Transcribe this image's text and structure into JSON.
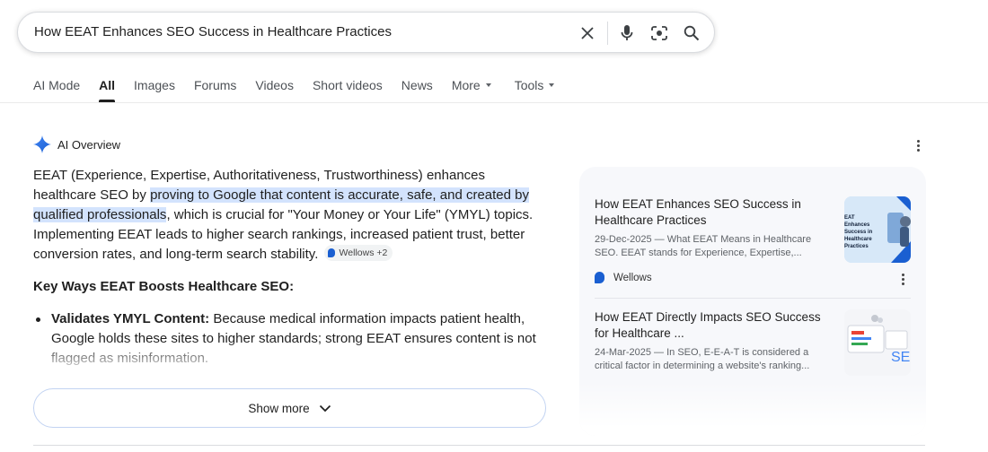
{
  "search": {
    "query": "How EEAT Enhances SEO Success in Healthcare Practices",
    "icons": [
      "close-icon",
      "microphone-icon",
      "lens-icon",
      "search-icon"
    ]
  },
  "tabs": [
    {
      "label": "AI Mode",
      "active": false
    },
    {
      "label": "All",
      "active": true
    },
    {
      "label": "Images",
      "active": false
    },
    {
      "label": "Forums",
      "active": false
    },
    {
      "label": "Videos",
      "active": false
    },
    {
      "label": "Short videos",
      "active": false
    },
    {
      "label": "News",
      "active": false
    },
    {
      "label": "More",
      "active": false,
      "dropdown": true
    },
    {
      "label": "Tools",
      "active": false,
      "dropdown": true
    }
  ],
  "ai_overview": {
    "title": "AI Overview",
    "p1_before": "EEAT (Experience, Expertise, Authoritativeness, Trustworthiness) enhances healthcare SEO by ",
    "p1_highlight": "proving to Google that content is accurate, safe, and created by qualified professionals",
    "p1_after": ", which is crucial for \"Your Money or Your Life\" (YMYL) topics. Implementing EEAT leads to higher search rankings, increased patient trust, better conversion rates, and long-term search stability.",
    "source_chip": "Wellows +2",
    "subheading": "Key Ways EEAT Boosts Healthcare SEO:",
    "bullet_bold": "Validates YMYL Content:",
    "bullet_text": " Because medical information impacts patient health, Google holds these sites to higher standards; strong EEAT ensures content is not flagged as misinformation.",
    "show_more": "Show more"
  },
  "sources": [
    {
      "title": "How EEAT Enhances SEO Success in Healthcare Practices",
      "snippet": "29-Dec-2025 — What EEAT Means in Healthcare SEO. EEAT stands for Experience, Expertise,...",
      "site": "Wellows",
      "thumb_text": "EAT Enhances Success in Healthcare Practices"
    },
    {
      "title": "How EEAT Directly Impacts SEO Success for Healthcare ...",
      "snippet": "24-Mar-2025 — In SEO, E-E-A-T is considered a critical factor in determining a website's ranking..."
    }
  ],
  "colors": {
    "highlight": "#d3e3fd",
    "accent": "#1a5fd1",
    "panel_bg": "#f7f8fb"
  }
}
